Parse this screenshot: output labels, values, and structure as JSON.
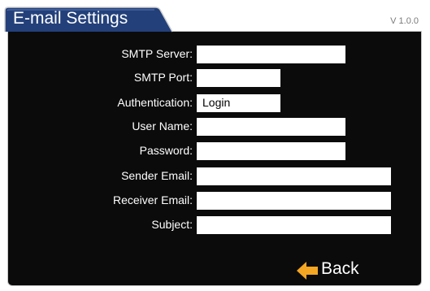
{
  "header": {
    "title": "E-mail Settings",
    "version": "V 1.0.0"
  },
  "form": {
    "smtp_server": {
      "label": "SMTP Server:",
      "value": ""
    },
    "smtp_port": {
      "label": "SMTP Port:",
      "value": ""
    },
    "authentication": {
      "label": "Authentication:",
      "value": "Login"
    },
    "user_name": {
      "label": "User Name:",
      "value": ""
    },
    "password": {
      "label": "Password:",
      "value": ""
    },
    "sender_email": {
      "label": "Sender Email:",
      "value": ""
    },
    "receiver_email": {
      "label": "Receiver Email:",
      "value": ""
    },
    "subject": {
      "label": "Subject:",
      "value": ""
    }
  },
  "footer": {
    "back_label": "Back",
    "back_icon": "arrow-left-icon"
  },
  "colors": {
    "panel_background": "#0b0b0b",
    "tab_fill": "#23407a",
    "back_arrow": "#f5a623",
    "text": "#ffffff"
  }
}
